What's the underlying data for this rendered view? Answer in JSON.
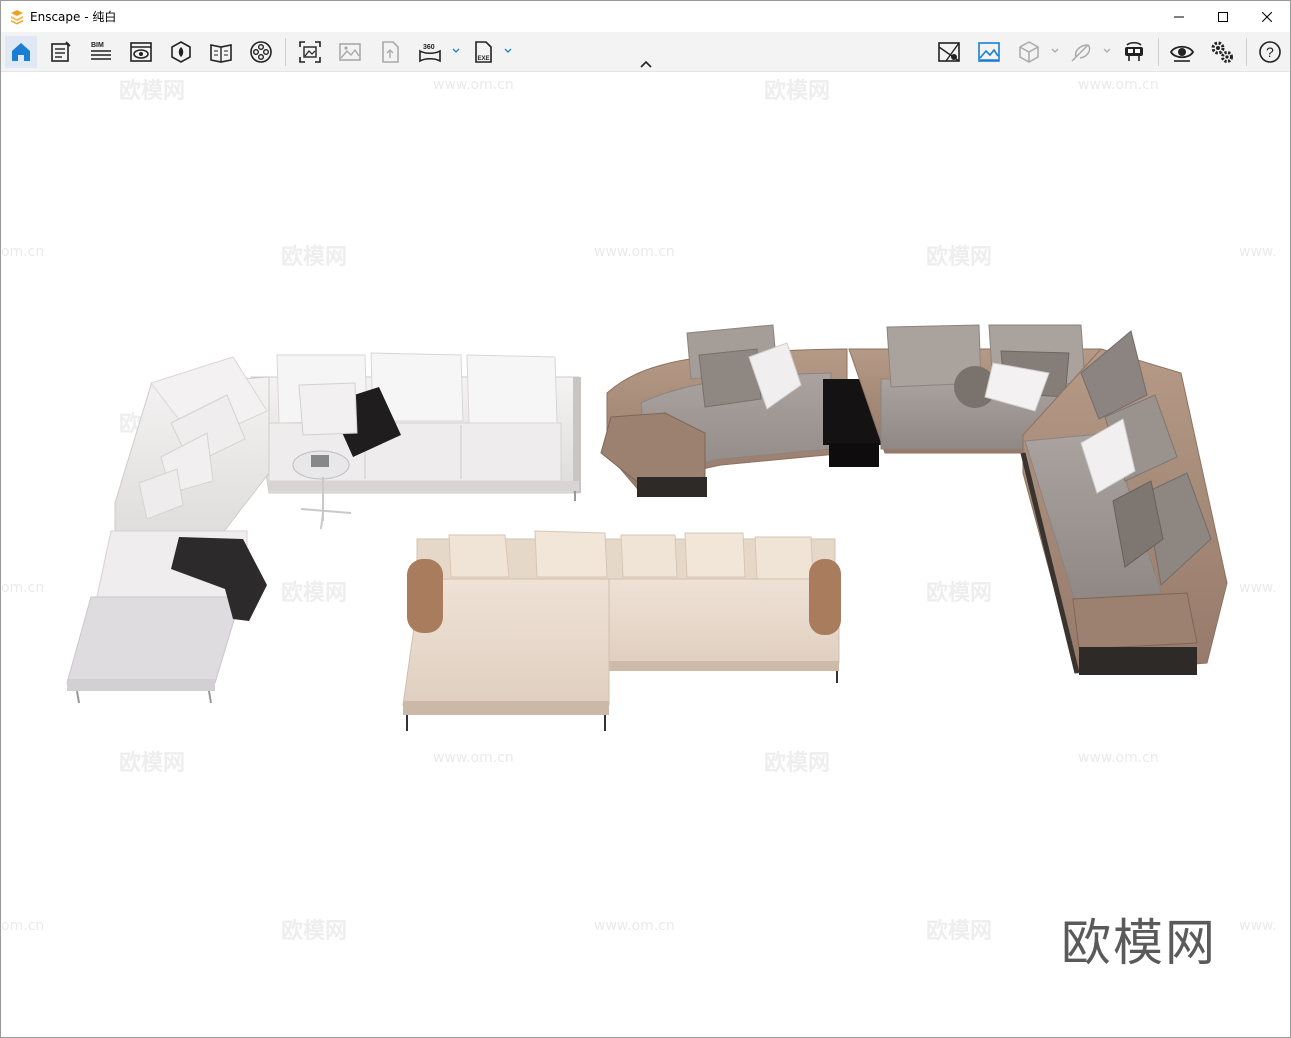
{
  "window": {
    "title": "Enscape - 纯白",
    "accent": "#1a7fd4",
    "logo_color": "#f0a020"
  },
  "toolbar": {
    "left_tools": [
      {
        "name": "home-icon"
      },
      {
        "name": "document-icon"
      },
      {
        "name": "bim-icon",
        "label": "BIM"
      },
      {
        "name": "view-icon"
      },
      {
        "name": "asset-library-icon"
      },
      {
        "name": "book-icon"
      },
      {
        "name": "video-reel-icon"
      },
      {
        "name": "screenshot-icon"
      },
      {
        "name": "image-icon"
      },
      {
        "name": "upload-icon"
      },
      {
        "name": "panorama-360-icon",
        "label": "360"
      },
      {
        "name": "exe-export-icon",
        "label": "EXE"
      }
    ],
    "right_tools": [
      {
        "name": "map-icon"
      },
      {
        "name": "landscape-icon"
      },
      {
        "name": "cube-icon"
      },
      {
        "name": "feather-icon"
      },
      {
        "name": "vr-headset-icon"
      },
      {
        "name": "eye-icon"
      },
      {
        "name": "settings-icon"
      },
      {
        "name": "help-icon",
        "label": "?"
      }
    ]
  },
  "viewport": {
    "watermark_text": "欧模网",
    "watermark_url": "www.om.cn",
    "url_fragment_left": "om.cn",
    "url_fragment_right": "www.",
    "brand_watermark": "欧模网"
  }
}
